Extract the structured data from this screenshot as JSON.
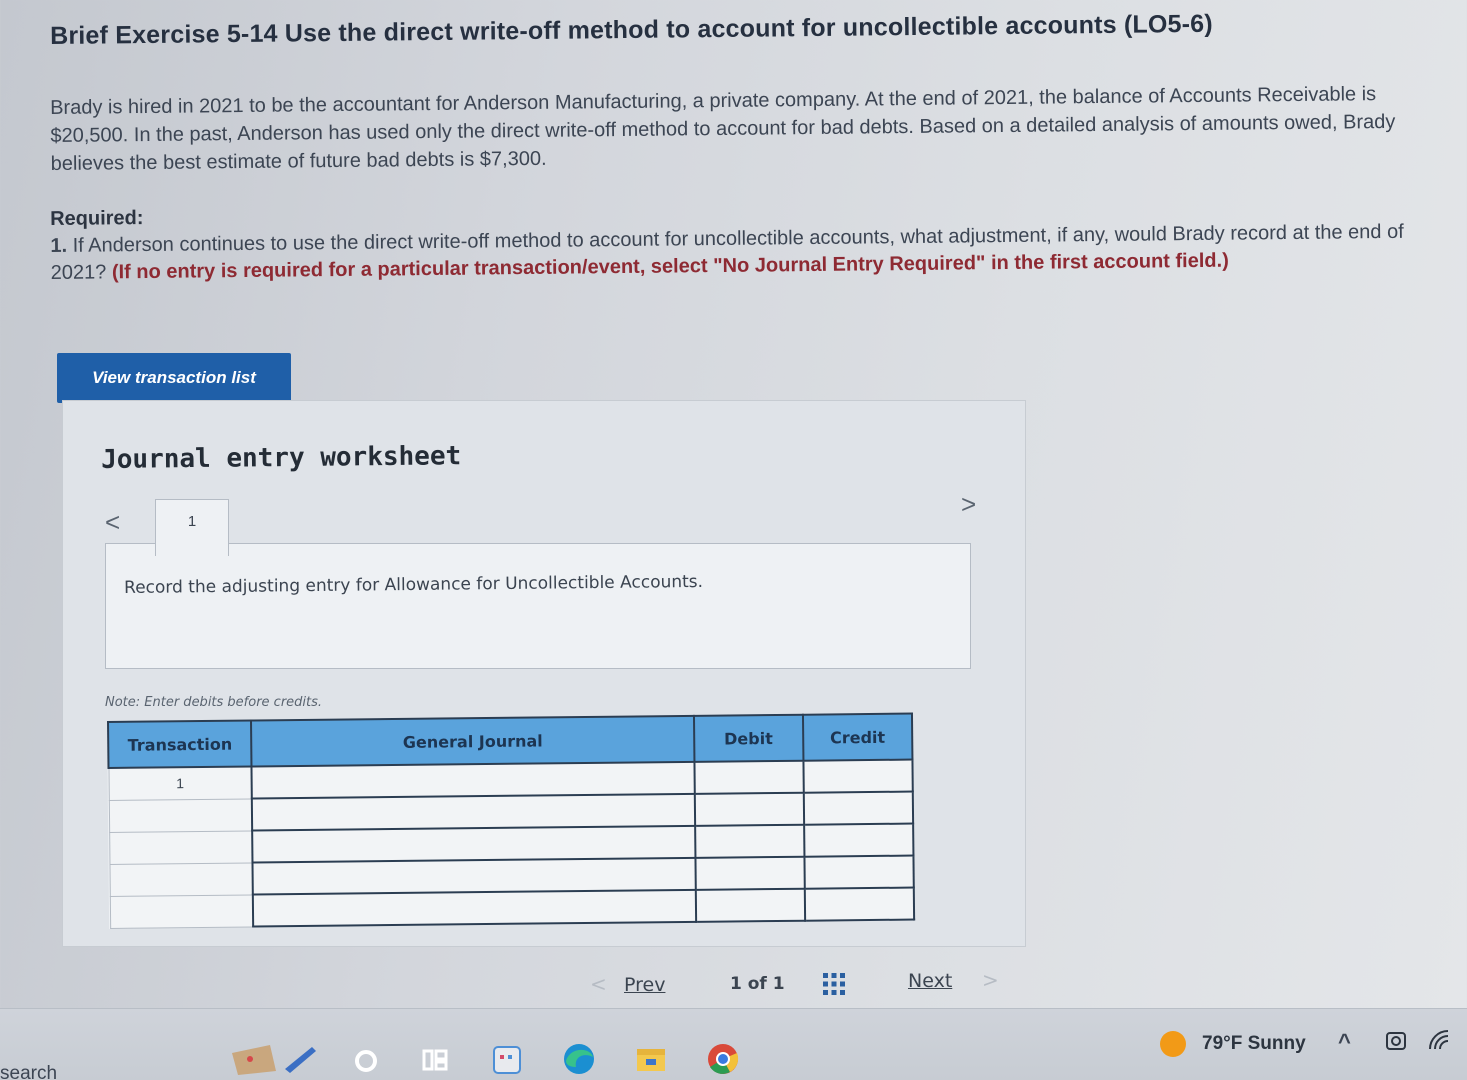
{
  "problem": {
    "title": "Brief Exercise 5-14 Use the direct write-off method to account for uncollectible accounts (LO5-6)",
    "intro": "Brady is hired in 2021 to be the accountant for Anderson Manufacturing, a private company. At the end of 2021, the balance of Accounts Receivable is $20,500. In the past, Anderson has used only the direct write-off method to account for bad debts. Based on a detailed analysis of amounts owed, Brady believes the best estimate of future bad debts is $7,300.",
    "required_label": "Required:",
    "question_number": "1.",
    "question_text": "If Anderson continues to use the direct write-off method to account for uncollectible accounts, what adjustment, if any, would Brady record at the end of 2021?",
    "question_note": "(If no entry is required for a particular transaction/event, select \"No Journal Entry Required\" in the first account field.)"
  },
  "view_button_label": "View transaction list",
  "worksheet": {
    "title": "Journal entry worksheet",
    "prev_arrow": "<",
    "next_arrow": ">",
    "active_tab": "1",
    "instruction": "Record the adjusting entry for Allowance for Uncollectible Accounts.",
    "note": "Note: Enter debits before credits.",
    "table": {
      "headers": [
        "Transaction",
        "General Journal",
        "Debit",
        "Credit"
      ],
      "rows": [
        {
          "transaction": "1",
          "account": "",
          "debit": "",
          "credit": ""
        },
        {
          "transaction": "",
          "account": "",
          "debit": "",
          "credit": ""
        },
        {
          "transaction": "",
          "account": "",
          "debit": "",
          "credit": ""
        },
        {
          "transaction": "",
          "account": "",
          "debit": "",
          "credit": ""
        },
        {
          "transaction": "",
          "account": "",
          "debit": "",
          "credit": ""
        }
      ]
    }
  },
  "pager": {
    "prev_chevron": "<",
    "prev_label": "Prev",
    "count": "1 of 1",
    "next_label": "Next",
    "next_chevron": ">"
  },
  "taskbar": {
    "search_label": "search",
    "weather": "79°F  Sunny",
    "tray_chevron": "^"
  },
  "colors": {
    "button_blue": "#1f5fa8",
    "table_header_blue": "#5aa3dc",
    "note_red": "#8e2a33",
    "sun_orange": "#f29a17"
  }
}
